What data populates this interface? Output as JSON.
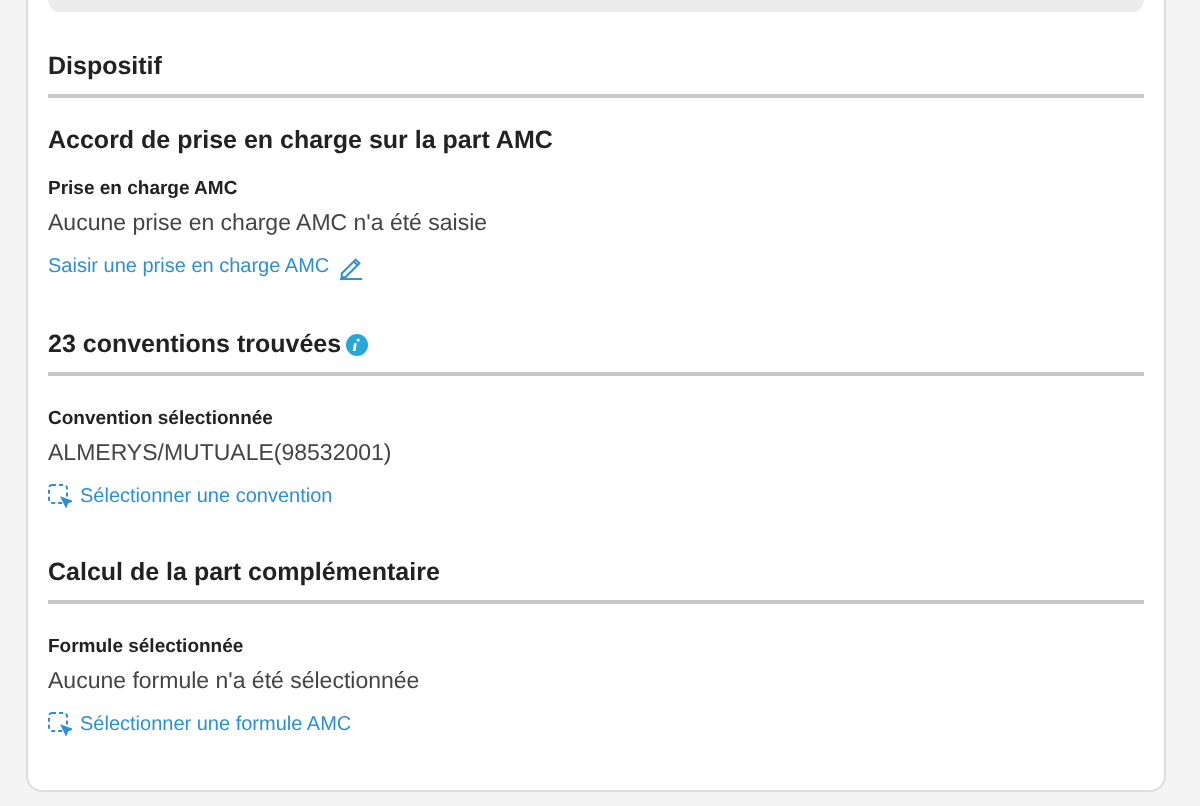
{
  "sections": [
    {
      "title": "Dispositif",
      "info": false,
      "blocks": [
        {
          "subtitle": "Accord de prise en charge sur la part AMC",
          "label": "Prise en charge AMC",
          "value": "Aucune prise en charge AMC n'a été saisie",
          "action": {
            "label": "Saisir une prise en charge AMC",
            "kind": "edit"
          }
        }
      ]
    },
    {
      "title": "23 conventions trouvées",
      "info": true,
      "blocks": [
        {
          "label": "Convention sélectionnée",
          "value": "ALMERYS/MUTUALE(98532001)",
          "action": {
            "label": "Sélectionner une convention",
            "kind": "select"
          }
        }
      ]
    },
    {
      "title": "Calcul de la part complémentaire",
      "info": false,
      "blocks": [
        {
          "label": "Formule sélectionnée",
          "value": "Aucune formule n'a été sélectionnée",
          "action": {
            "label": "Sélectionner une formule AMC",
            "kind": "select"
          }
        }
      ]
    }
  ]
}
